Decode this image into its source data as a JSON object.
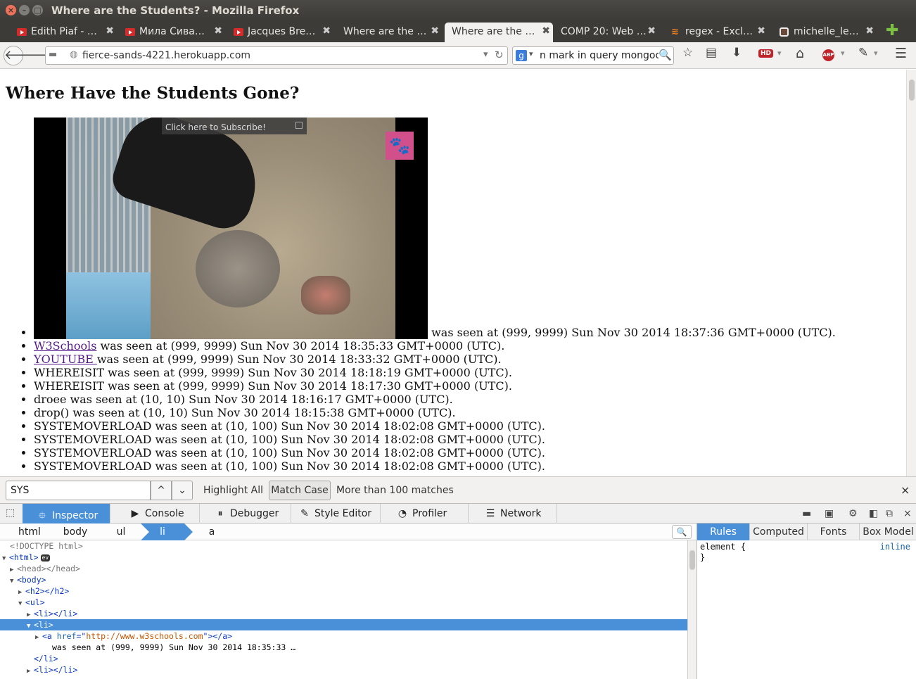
{
  "window": {
    "title": "Where are the Students? - Mozilla Firefox",
    "close_glyph": "×",
    "min_glyph": "–",
    "max_glyph": "□"
  },
  "tabs": [
    {
      "label": "Edith Piaf - …",
      "icon": "youtube-icon"
    },
    {
      "label": "Мила Сива…",
      "icon": "youtube-icon"
    },
    {
      "label": "Jacques Bre…",
      "icon": "youtube-icon"
    },
    {
      "label": "Where are the …",
      "icon": ""
    },
    {
      "label": "Where are the …",
      "icon": "",
      "active": true
    },
    {
      "label": "COMP 20: Web …",
      "icon": ""
    },
    {
      "label": "regex - Excl…",
      "icon": "stackoverflow-icon"
    },
    {
      "label": "michelle_le…",
      "icon": "instagram-icon"
    }
  ],
  "tab_close_glyph": "✖",
  "new_tab_glyph": "✚",
  "nav": {
    "url": "fierce-sands-4221.herokuapp.com",
    "search_text": "n mark in query mongodb",
    "back_glyph": "🡐",
    "forward_glyph": "🡒",
    "dropdown_glyph": "▾",
    "reload_glyph": "↻",
    "search_engine_glyph": "g",
    "search_glyph": "🔍",
    "star_glyph": "☆",
    "reader_glyph": "▤",
    "download_glyph": "⬇",
    "hd_label": "HD",
    "home_glyph": "⌂",
    "abp_label": "ABP",
    "dev_glyph": "✎",
    "menu_glyph": "☰"
  },
  "page": {
    "heading": "Where Have the Students Gone?",
    "video": {
      "subscribe_tip": "Click here to Subscribe!",
      "paw_glyph": "🐾"
    },
    "items": [
      {
        "link": "",
        "text": " was seen at (999, 9999) Sun Nov 30 2014 18:37:36 GMT+0000 (UTC)."
      },
      {
        "link": "W3Schools",
        "text": " was seen at (999, 9999) Sun Nov 30 2014 18:35:33 GMT+0000 (UTC)."
      },
      {
        "link": "YOUTUBE ",
        "text": "was seen at (999, 9999) Sun Nov 30 2014 18:33:32 GMT+0000 (UTC)."
      },
      {
        "link": "",
        "text": "WHEREISIT was seen at (999, 9999) Sun Nov 30 2014 18:18:19 GMT+0000 (UTC)."
      },
      {
        "link": "",
        "text": "WHEREISIT was seen at (999, 9999) Sun Nov 30 2014 18:17:30 GMT+0000 (UTC)."
      },
      {
        "link": "",
        "text": "droee was seen at (10, 10) Sun Nov 30 2014 18:16:17 GMT+0000 (UTC)."
      },
      {
        "link": "",
        "text": "drop() was seen at (10, 10) Sun Nov 30 2014 18:15:38 GMT+0000 (UTC)."
      },
      {
        "link": "",
        "text": "SYSTEMOVERLOAD was seen at (10, 100) Sun Nov 30 2014 18:02:08 GMT+0000 (UTC)."
      },
      {
        "link": "",
        "text": "SYSTEMOVERLOAD was seen at (10, 100) Sun Nov 30 2014 18:02:08 GMT+0000 (UTC)."
      },
      {
        "link": "",
        "text": "SYSTEMOVERLOAD was seen at (10, 100) Sun Nov 30 2014 18:02:08 GMT+0000 (UTC)."
      },
      {
        "link": "",
        "text": "SYSTEMOVERLOAD was seen at (10, 100) Sun Nov 30 2014 18:02:08 GMT+0000 (UTC)."
      }
    ]
  },
  "findbar": {
    "query": "SYS",
    "prev_glyph": "^",
    "next_glyph": "⌄",
    "highlight_all": "Highlight All",
    "match_case": "Match Case",
    "status": "More than 100 matches",
    "close_glyph": "×"
  },
  "devtools": {
    "tabs": [
      {
        "label": "Inspector",
        "icon": "⯐",
        "active": true
      },
      {
        "label": "Console",
        "icon": "▶"
      },
      {
        "label": "Debugger",
        "icon": "⏸"
      },
      {
        "label": "Style Editor",
        "icon": "✎"
      },
      {
        "label": "Profiler",
        "icon": "◔"
      },
      {
        "label": "Network",
        "icon": "☰"
      }
    ],
    "pick_glyph": "⬚",
    "right_icons": [
      "▬",
      "▣",
      "⚙",
      "◧",
      "⧉",
      "×"
    ],
    "breadcrumbs": [
      "html",
      "body",
      "ul",
      "li",
      "a"
    ],
    "active_crumb": 3,
    "crumb_search_glyph": "🔍",
    "markup": {
      "doctype": "<!DOCTYPE html>",
      "html_open": "<html>",
      "ev_badge": "ev",
      "head": "<head></head>",
      "body_open": "<body>",
      "h2": "<h2></h2>",
      "ul_open": "<ul>",
      "li_collapsed": "<li></li>",
      "li_open": "<li>",
      "a_open": "<a ",
      "a_attr": "href",
      "a_eq": "=\"",
      "a_value": "http://www.w3schools.com",
      "a_close": "\"></a>",
      "text_node": "was seen at (999, 9999) Sun Nov 30 2014 18:35:33 …",
      "li_close": "</li>",
      "li_collapsed2": "<li></li>"
    },
    "sidebar_tabs": [
      "Rules",
      "Computed",
      "Fonts",
      "Box Model"
    ],
    "rules_text": "element {",
    "rules_close": "}",
    "inline_label": "inline"
  }
}
